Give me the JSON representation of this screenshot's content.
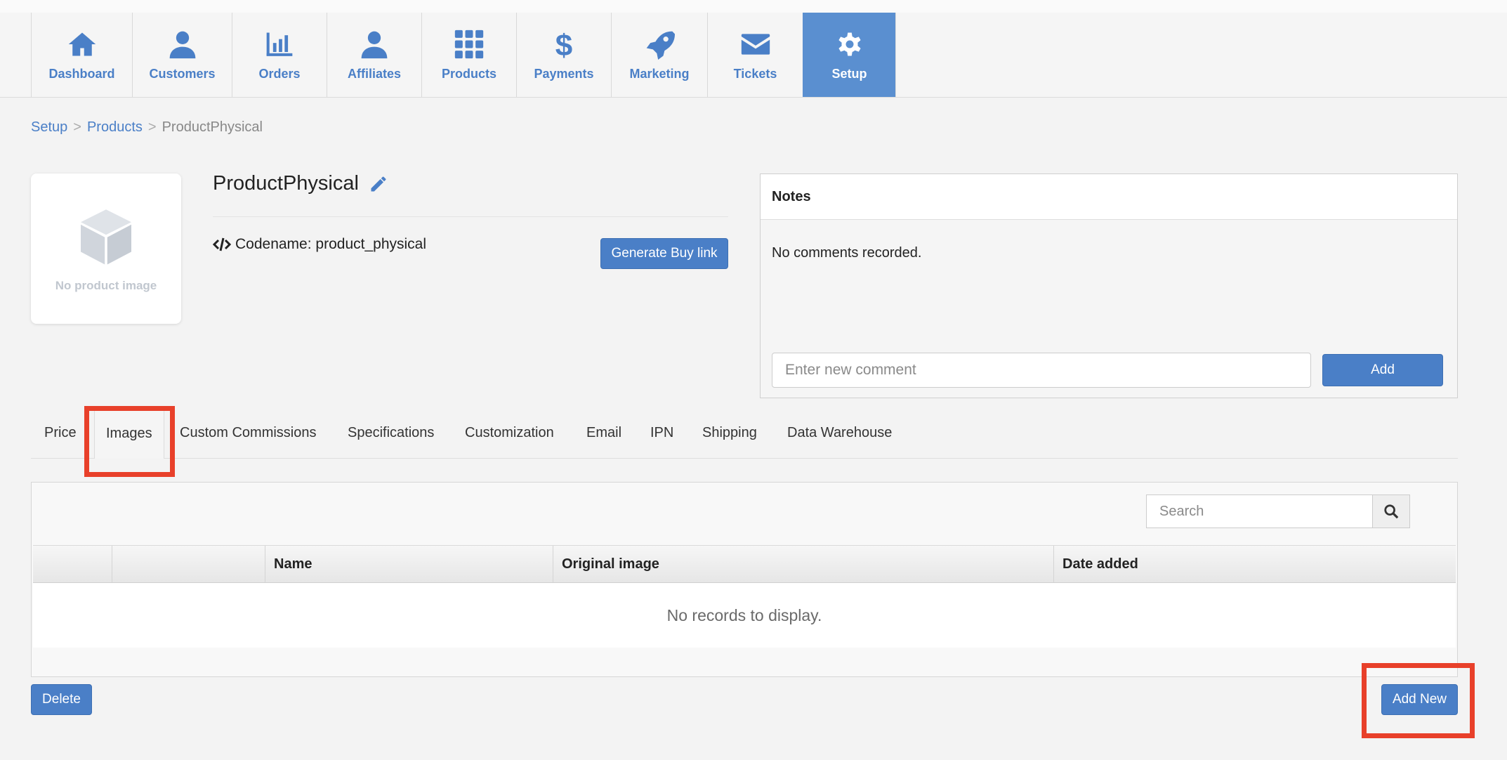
{
  "nav": {
    "items": [
      {
        "label": "Dashboard",
        "icon": "home-icon"
      },
      {
        "label": "Customers",
        "icon": "user-icon"
      },
      {
        "label": "Orders",
        "icon": "bar-chart-icon"
      },
      {
        "label": "Affiliates",
        "icon": "user-icon"
      },
      {
        "label": "Products",
        "icon": "grid-icon"
      },
      {
        "label": "Payments",
        "icon": "dollar-icon"
      },
      {
        "label": "Marketing",
        "icon": "rocket-icon"
      },
      {
        "label": "Tickets",
        "icon": "envelope-icon"
      },
      {
        "label": "Setup",
        "icon": "gear-icon"
      }
    ],
    "active": "Setup",
    "accent": "#4a7fc7",
    "active_bg": "#5a8fd0"
  },
  "breadcrumb": {
    "items": [
      "Setup",
      "Products",
      "ProductPhysical"
    ],
    "separator": ">"
  },
  "product": {
    "image_caption": "No product image",
    "title": "ProductPhysical",
    "codename_label": "Codename:",
    "codename": "product_physical",
    "generate_button": "Generate Buy link"
  },
  "notes": {
    "title": "Notes",
    "empty_text": "No comments recorded.",
    "input_placeholder": "Enter new comment",
    "add_button": "Add"
  },
  "tabs": {
    "items": [
      "Price",
      "Images",
      "Custom Commissions",
      "Specifications",
      "Customization",
      "Email",
      "IPN",
      "Shipping",
      "Data Warehouse"
    ],
    "active": "Images"
  },
  "grid": {
    "search_placeholder": "Search",
    "columns": [
      "",
      "",
      "Name",
      "Original image",
      "Date added"
    ],
    "empty_text": "No records to display."
  },
  "actions": {
    "delete": "Delete",
    "add_new": "Add New"
  },
  "highlight_color": "#e8402a"
}
